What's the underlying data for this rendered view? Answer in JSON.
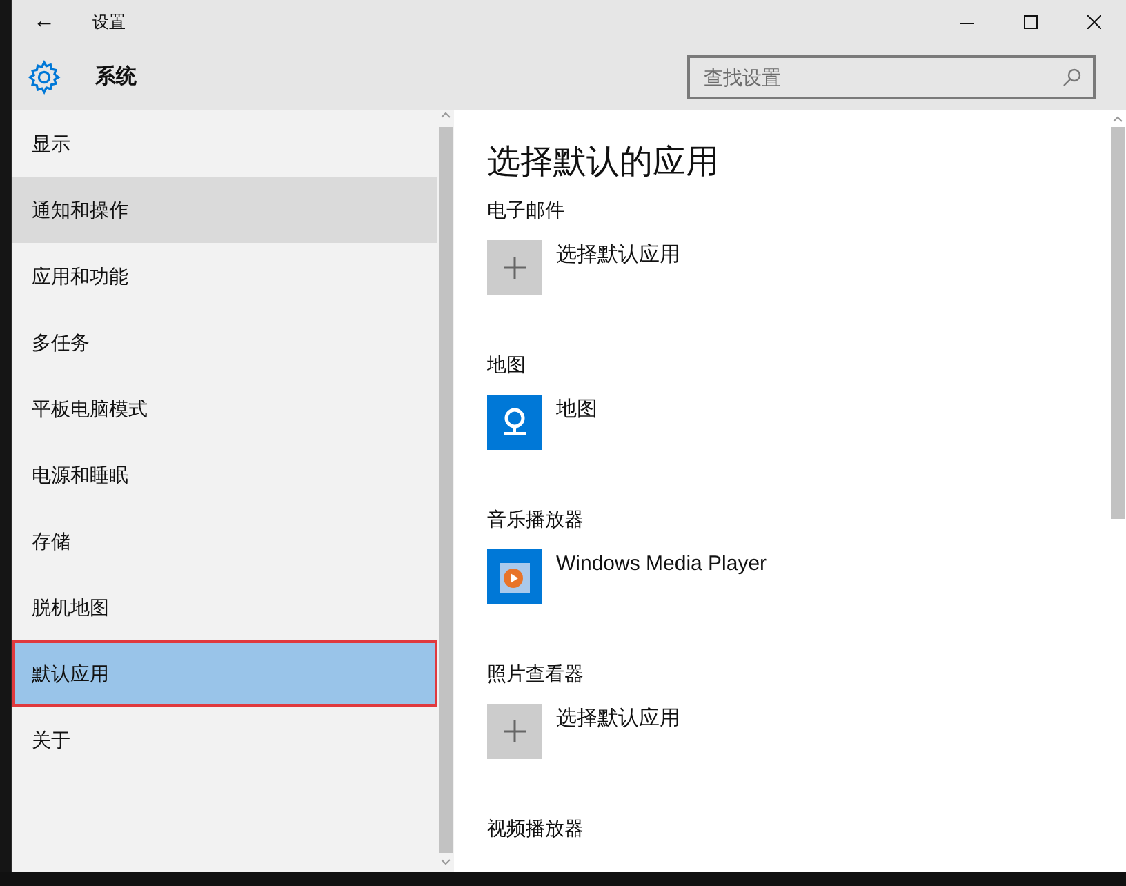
{
  "window": {
    "back": "←",
    "title": "设置"
  },
  "header": {
    "title": "系统",
    "search": {
      "placeholder": "查找设置"
    }
  },
  "sidebar": {
    "items": [
      {
        "label": "显示",
        "selected": false,
        "hovered": false,
        "outlined": false
      },
      {
        "label": "通知和操作",
        "selected": false,
        "hovered": true,
        "outlined": false
      },
      {
        "label": "应用和功能",
        "selected": false,
        "hovered": false,
        "outlined": false
      },
      {
        "label": "多任务",
        "selected": false,
        "hovered": false,
        "outlined": false
      },
      {
        "label": "平板电脑模式",
        "selected": false,
        "hovered": false,
        "outlined": false
      },
      {
        "label": "电源和睡眠",
        "selected": false,
        "hovered": false,
        "outlined": false
      },
      {
        "label": "存储",
        "selected": false,
        "hovered": false,
        "outlined": false
      },
      {
        "label": "脱机地图",
        "selected": false,
        "hovered": false,
        "outlined": false
      },
      {
        "label": "默认应用",
        "selected": true,
        "hovered": false,
        "outlined": true
      },
      {
        "label": "关于",
        "selected": false,
        "hovered": false,
        "outlined": false
      }
    ]
  },
  "content": {
    "title": "选择默认的应用",
    "sections": [
      {
        "heading": "电子邮件",
        "app": {
          "kind": "add",
          "label": "选择默认应用"
        }
      },
      {
        "heading": "地图",
        "app": {
          "kind": "maps",
          "label": "地图"
        }
      },
      {
        "heading": "音乐播放器",
        "app": {
          "kind": "media",
          "label": "Windows Media Player"
        }
      },
      {
        "heading": "照片查看器",
        "app": {
          "kind": "add",
          "label": "选择默认应用"
        }
      },
      {
        "heading": "视频播放器"
      }
    ]
  }
}
